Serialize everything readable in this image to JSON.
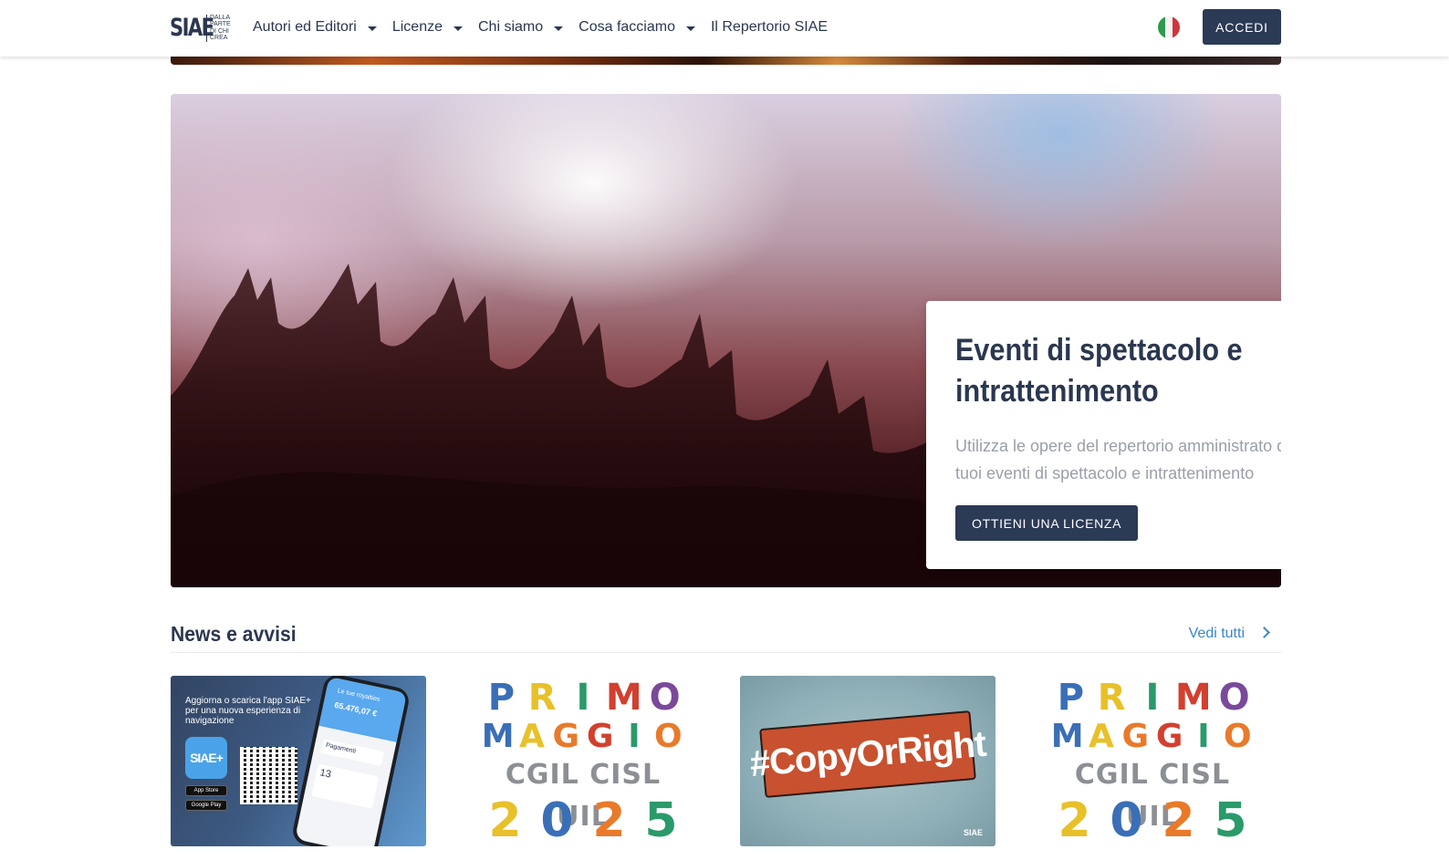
{
  "header": {
    "logo_mark": "SIAE",
    "logo_tagline": [
      "DALLA",
      "PARTE",
      "DI CHI",
      "CREA"
    ],
    "nav": [
      {
        "label": "Autori ed Editori",
        "has_dropdown": true
      },
      {
        "label": "Licenze",
        "has_dropdown": true
      },
      {
        "label": "Chi siamo",
        "has_dropdown": true
      },
      {
        "label": "Cosa facciamo",
        "has_dropdown": true
      },
      {
        "label": "Il Repertorio SIAE",
        "has_dropdown": false
      }
    ],
    "language_flag": "italy-flag-icon",
    "login_label": "ACCEDI"
  },
  "hero": {
    "title": "Eventi di spettacolo e intrattenimento",
    "text": "Utilizza le opere del repertorio amministrato da SIAE nei tuoi eventi di spettacolo e intrattenimento",
    "cta_label": "OTTIENI UNA LICENZA"
  },
  "news": {
    "title": "News e avvisi",
    "see_all_label": "Vedi tutti",
    "cards": [
      {
        "app_text": "Aggiorna o scarica l'app SIAE+ per una nuova esperienza di navigazione",
        "app_badge": "SIAE+",
        "app_store": "App Store",
        "google_play": "Google Play",
        "phone_label": "Le tue royalties",
        "phone_amount": "65.476,07 €",
        "phone_row1": "Pagamenti",
        "phone_row2": "13"
      },
      {
        "row1": [
          "P",
          "R",
          "I",
          "M",
          "O"
        ],
        "row2": [
          "M",
          "A",
          "G",
          "G",
          "I",
          "O"
        ],
        "row3": "CGIL CISL UIL",
        "row4": [
          "2",
          "0",
          "2",
          "5"
        ]
      },
      {
        "hashtag": "#CopyOrRight",
        "mark": "SIAE"
      },
      {
        "row1": [
          "P",
          "R",
          "I",
          "M",
          "O"
        ],
        "row2": [
          "M",
          "A",
          "G",
          "G",
          "I",
          "O"
        ],
        "row3": "CGIL CISL UIL",
        "row4": [
          "2",
          "0",
          "2",
          "5"
        ]
      }
    ]
  },
  "colors": {
    "brand_navy": "#2b3a55",
    "link_blue": "#3a86c8",
    "muted_text": "#9a9fa8",
    "pm_palette": [
      "#3a6fb8",
      "#e8c02a",
      "#d2402f",
      "#7a4a9a",
      "#e87a2a",
      "#2a9a6a"
    ]
  }
}
